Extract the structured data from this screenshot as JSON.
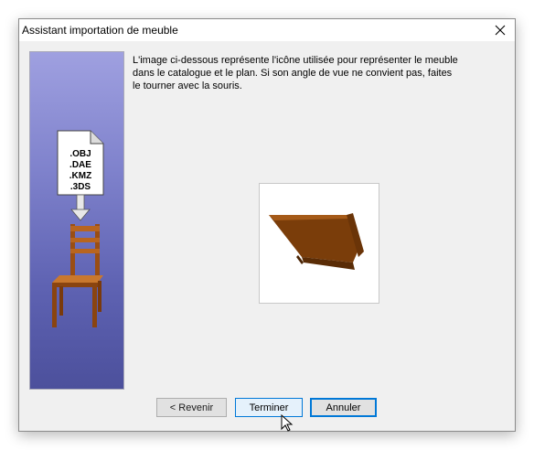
{
  "window": {
    "title": "Assistant importation de meuble",
    "close_icon": "close-icon"
  },
  "side_panel": {
    "file_formats": [
      ".OBJ",
      ".DAE",
      ".KMZ",
      ".3DS"
    ],
    "document_icon": "document-icon",
    "arrow_icon": "arrow-down-icon",
    "chair_icon": "chair-icon"
  },
  "content": {
    "description": "L'image ci-dessous représente l'icône utilisée pour représenter le meuble dans le catalogue et le plan. Si son angle de vue ne convient pas, faites le tourner avec la souris.",
    "preview_icon": "shelf-model-icon"
  },
  "buttons": {
    "back_label": "< Revenir",
    "finish_label": "Terminer",
    "cancel_label": "Annuler"
  },
  "colors": {
    "accent": "#0078d7",
    "panel_top": "#9fa0e0",
    "panel_bottom": "#4c509c",
    "wood": "#8a4a10"
  }
}
